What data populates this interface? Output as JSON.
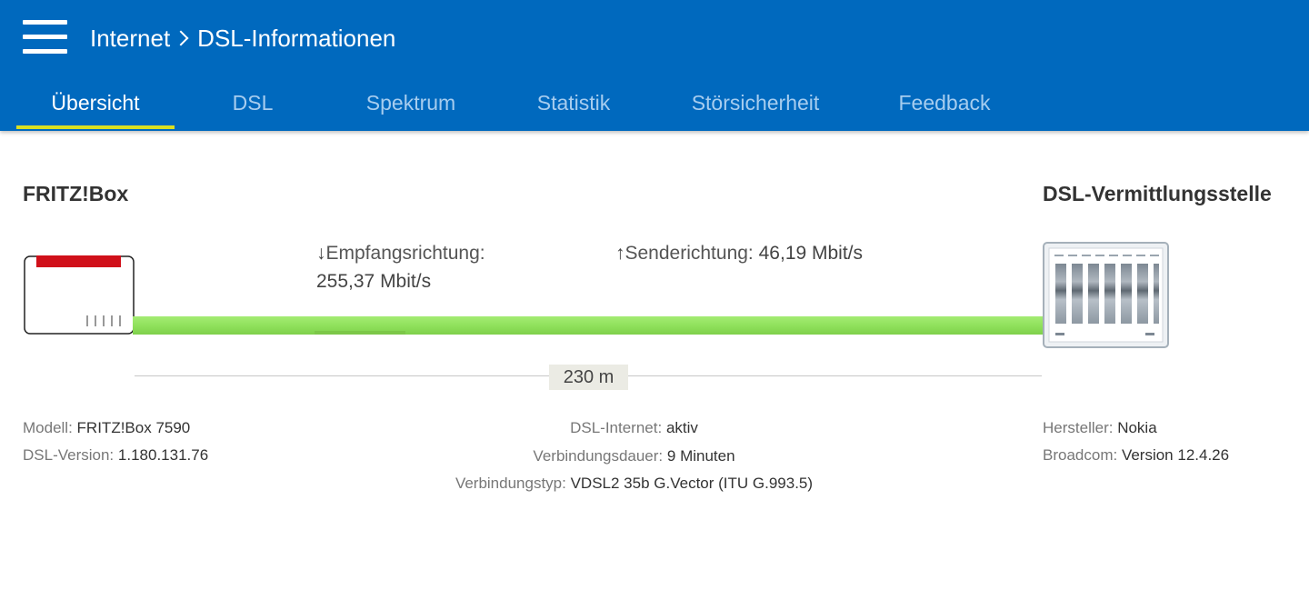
{
  "header": {
    "breadcrumb": {
      "parent": "Internet",
      "current": "DSL-Informationen"
    },
    "tabs": [
      {
        "label": "Übersicht",
        "active": true
      },
      {
        "label": "DSL",
        "active": false
      },
      {
        "label": "Spektrum",
        "active": false
      },
      {
        "label": "Statistik",
        "active": false
      },
      {
        "label": "Störsicherheit",
        "active": false
      },
      {
        "label": "Feedback",
        "active": false
      }
    ],
    "colors": {
      "background": "#0069be",
      "active_tab_underline": "#d9e021"
    }
  },
  "overview": {
    "left_device_title": "FRITZ!Box",
    "right_device_title": "DSL-Vermittlungsstelle",
    "downstream": {
      "arrow": "↓",
      "label": "Empfangsrichtung:",
      "value": "255,37 Mbit/s"
    },
    "upstream": {
      "arrow": "↑",
      "label": "Senderichtung:",
      "value": "46,19 Mbit/s"
    },
    "distance": "230 m",
    "cable_color": "#8ee05a"
  },
  "info_left": [
    {
      "key": "Modell:",
      "value": "FRITZ!Box 7590"
    },
    {
      "key": "DSL-Version:",
      "value": "1.180.131.76"
    }
  ],
  "info_center": [
    {
      "key": "DSL-Internet:",
      "value": "aktiv"
    },
    {
      "key": "Verbindungsdauer:",
      "value": "9 Minuten"
    },
    {
      "key": "Verbindungstyp:",
      "value": "VDSL2 35b G.Vector (ITU G.993.5)"
    }
  ],
  "info_right": [
    {
      "key": "Hersteller:",
      "value": "Nokia"
    },
    {
      "key": "Broadcom:",
      "value": "Version 12.4.26"
    }
  ],
  "icons": {
    "menu": "hamburger-menu-icon",
    "separator": "chevron-right-icon",
    "fritzbox": "fritzbox-router-icon",
    "dslam": "dsl-exchange-icon"
  }
}
